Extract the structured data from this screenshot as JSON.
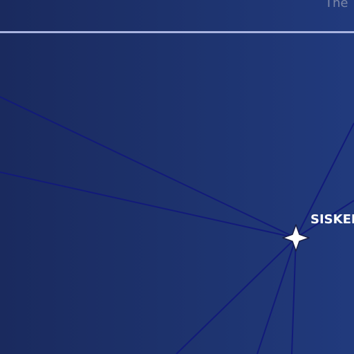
{
  "header": {
    "fragment_text": "The"
  },
  "map": {
    "waypoint": {
      "label": "SISKEE",
      "icon": "four-point-star-icon",
      "icon_color": "#ffffff"
    },
    "route_color": "#121a7a",
    "background_color": "#1e3470",
    "divider_color": "#a9b4e0"
  }
}
